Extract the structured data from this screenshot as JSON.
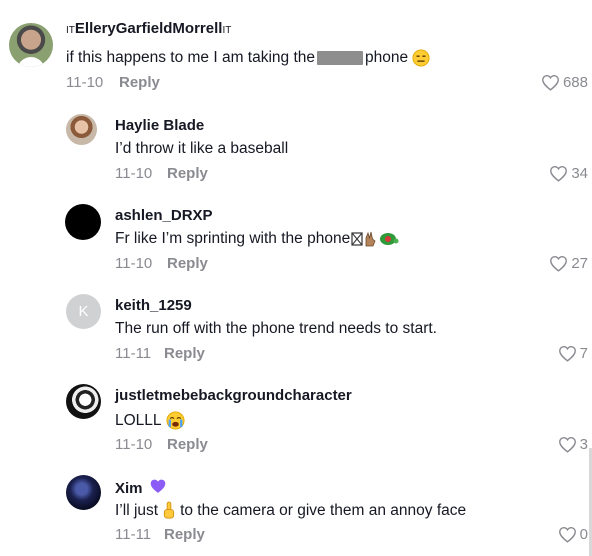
{
  "comments": [
    {
      "username_prefix": "IT",
      "username": "ElleryGarfieldMorrell",
      "username_suffix": "IT",
      "text_before": "if this happens to me I am taking the",
      "text_after": "phone",
      "emoji": "expressionless-face",
      "date": "11-10",
      "reply_label": "Reply",
      "likes": "688",
      "avatar": "photo-man-outdoors"
    },
    {
      "username": "Haylie Blade",
      "text": "I’d throw it like a baseball",
      "date": "11-10",
      "reply_label": "Reply",
      "likes": "34",
      "avatar": "photo-woman"
    },
    {
      "username": "ashlen_DRXP",
      "text": "Fr like I’m sprinting with the phone",
      "emoji": "hand-sign-and-turtle",
      "date": "11-10",
      "reply_label": "Reply",
      "likes": "27",
      "avatar": "black-circle"
    },
    {
      "username": "keith_1259",
      "avatar_letter": "K",
      "text": "The run off with the phone trend needs to start.",
      "date": "11-11",
      "reply_label": "Reply",
      "likes": "7",
      "avatar": "letter-k"
    },
    {
      "username": "justletmebebackgroundcharacter",
      "text": "LOLLL",
      "emoji": "crying-face",
      "date": "11-10",
      "reply_label": "Reply",
      "likes": "3",
      "avatar": "anime-drawing"
    },
    {
      "username": "Xim",
      "badge": "purple-heart",
      "text_before": "I’ll just",
      "text_after": "to the camera or give them an annoy face",
      "emoji": "finger-hand",
      "date": "11-11",
      "reply_label": "Reply",
      "likes": "0",
      "avatar": "dark-blue-photo"
    }
  ],
  "colors": {
    "text": "#161823",
    "muted": "#8a8b91",
    "heart": "#8a8b91",
    "censor": "#8e8e8e",
    "badge": "#8b5cf6"
  }
}
